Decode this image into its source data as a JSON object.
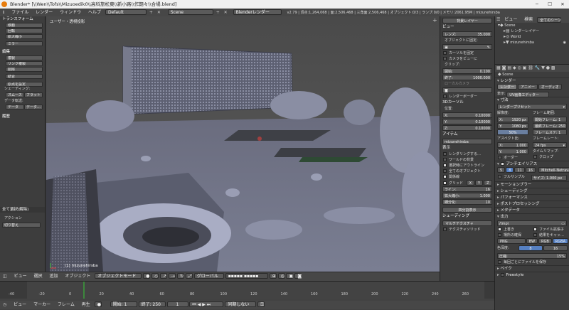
{
  "window": {
    "title": "Blender* [\\\\Wen\\\\Tofs\\\\Mizuoedik0\\\\高科旅松東\\\\新小路\\\\作期々\\\\合場.blend]"
  },
  "menubar": {
    "items": [
      "ファイル",
      "レンダー",
      "ウィンドウ",
      "ヘルプ"
    ],
    "layout": "Default",
    "scene": "Scene",
    "engine": "Blenderレンダー",
    "stats": "v2.79 | 頂点:1,264,068 | 面:2,506,468 | 三角面:2,506,468 | オブジェクト:0/3 | ランプ:0/0 | メモリ:2061.95M | mizunehirsba"
  },
  "left_panel": {
    "transform_header": "トランスフォーム",
    "transform_buttons": [
      "移動",
      "回転",
      "拡大縮小",
      "ミラー"
    ],
    "edit_header": "編集",
    "edit_buttons": [
      "複製",
      "リンク複製",
      "削除",
      "結合"
    ],
    "origin_btn": "原点を設定",
    "shading_label": "シェーディング:",
    "smooth": "スムース",
    "flat": "フラット",
    "data_label": "データ転送:",
    "data_btn": "データ",
    "data2_btn": "データ…",
    "history": "履歴",
    "op_header": "全て選択(解除)",
    "action_label": "アクション",
    "action_value": "切り替え"
  },
  "viewport": {
    "label": "ユーザー・透視投影",
    "object": "(1) mizunehirsba"
  },
  "viewport_header": {
    "items": [
      "ビュー",
      "選択",
      "追加",
      "オブジェクト"
    ],
    "mode": "オブジェクトモード",
    "pivot": "グローバル"
  },
  "npanel": {
    "btn_view_layer": "背景レイヤー",
    "view": "ビュー",
    "lens_label": "レンズ:",
    "lens": "35.000",
    "lock_label": "オブジェクトに固定:",
    "lock_cursor": "カーソルを固定",
    "lock_camera": "カメラをビューに",
    "clip_label": "クリップ:",
    "clip_start_label": "開始:",
    "clip_start": "0.100",
    "clip_end_label": "終了:",
    "clip_end": "1000.000",
    "local_camera": "ローカルカメラ",
    "render_border": "レンダーボーダー",
    "cursor3d": "3Dカーソル",
    "location_label": "位置:",
    "x_label": "X:",
    "x": "0.10000",
    "y_label": "Y:",
    "y": "0.10000",
    "z_label": "Z:",
    "z": "0.10000",
    "item": "アイテム",
    "item_name": "mizunehirsba",
    "display": "表示",
    "disp_items": [
      "レンダリングする…",
      "ワールドの背景",
      "選択時にアウトライン",
      "全てのオブジェクト",
      "関係線"
    ],
    "grid_label": "グリッド",
    "axes": [
      "X",
      "Y",
      "Z"
    ],
    "lines_label": "ライン:",
    "lines": "16",
    "scale_label": "拡大縮小:",
    "scale": "1.000",
    "subdiv_label": "細分化:",
    "subdiv": "10",
    "toggle_quad": "四分割表示",
    "shading_header": "シェーディング",
    "matcap": "マルチテクスチャ",
    "texture_solid": "テクスチャソリッド"
  },
  "outliner": {
    "hdr_view": "ビュー",
    "hdr_search": "検索",
    "hdr_all": "全てのシーン",
    "scene": "Scene",
    "render_layer": "レンダーレイヤー",
    "world": "World",
    "object": "mizunehirsba"
  },
  "props": {
    "scene_label": "Scene",
    "render_header": "レンダー",
    "tab_render": "レンダー",
    "tab_anim": "アニメー",
    "tab_audio": "オーディオ",
    "display_label": "表示:",
    "display_value": "UV画像エディター",
    "dims_header": "寸法",
    "preset": "レンダープリセット",
    "res_label": "解像度:",
    "res_x": "1920 px",
    "res_y": "1080 px",
    "res_pct": "50%",
    "frame_label": "フレーム範囲:",
    "frame_start": "開始フレーム: 1",
    "frame_end": "最終フレーム: 250",
    "frame_step": "フレームステ: 1",
    "aspect_label": "アスペクト比:",
    "asp_x": "1.000",
    "asp_y": "1.000",
    "fps_label": "フレームレート:",
    "fps": "24 fps",
    "remap_label": "タイムリマップ:",
    "border": "ボーダー",
    "crop": "クロップ",
    "aa_header": "アンチエイリアス",
    "aa_values": [
      "5",
      "8",
      "11",
      "16"
    ],
    "filter": "Mitchell-Netravali",
    "full_sample": "フルサンプル",
    "filter_size": "サイズ: 1.000 px",
    "sections": [
      "モーションブラー",
      "シェーディング",
      "パフォーマンス",
      "ポストプロセッシング",
      "メタデータ"
    ],
    "output_header": "出力",
    "output_path": "/tmp\\",
    "overwrite": "上書き",
    "file_ext": "ファイル拡張子",
    "placeholders": "場所の確保",
    "cache_result": "結果をキャッ…",
    "format": "PNG",
    "bw": "BW",
    "rgb": "RGB",
    "rgba": "RGBA",
    "color_depth_label": "色深度:",
    "depth8": "8",
    "depth16": "16",
    "compress_label": "圧縮:",
    "compress": "15%",
    "save_bytes": "毎回ごとにファイルを保存",
    "bake": "ベイク",
    "freestyle": "Freestyle"
  },
  "timeline": {
    "ticks": [
      "-40",
      "-20",
      "0",
      "20",
      "40",
      "60",
      "80",
      "100",
      "120",
      "140",
      "160",
      "180",
      "200",
      "220",
      "240",
      "260"
    ],
    "items": [
      "ビュー",
      "マーカー",
      "フレーム",
      "再生"
    ],
    "start_label": "開始:",
    "start": "1",
    "end_label": "終了:",
    "end": "250",
    "current": "1",
    "sync": "同期しない"
  }
}
